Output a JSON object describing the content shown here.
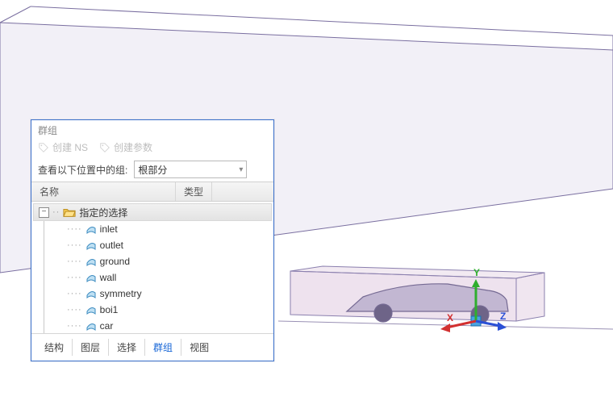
{
  "panel": {
    "title": "群组",
    "toolbar": {
      "create_ns": "创建 NS",
      "create_param": "创建参数"
    },
    "lookup_label": "查看以下位置中的组:",
    "combo_value": "根部分",
    "columns": {
      "name": "名称",
      "type": "类型"
    },
    "tree": {
      "root_label": "指定的选择",
      "items": [
        "inlet",
        "outlet",
        "ground",
        "wall",
        "symmetry",
        "boi1",
        "car"
      ]
    },
    "tabs": {
      "structure": "结构",
      "layer": "图层",
      "selection": "选择",
      "group": "群组",
      "view": "视图"
    }
  },
  "gizmo": {
    "x": "X",
    "y": "Y",
    "z": "Z"
  }
}
